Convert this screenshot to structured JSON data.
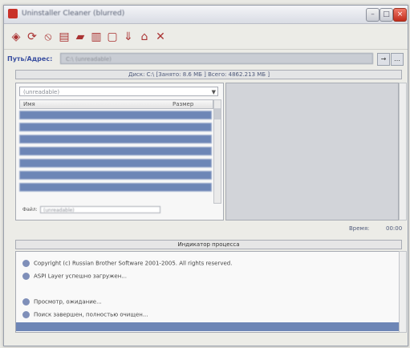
{
  "window": {
    "title": "Uninstaller Cleaner (blurred)"
  },
  "toolbar": {
    "icons": [
      "search-icon",
      "refresh-icon",
      "stop-icon",
      "document-icon",
      "folder-icon",
      "trash-icon",
      "settings-icon",
      "arrow-down-icon",
      "home-icon",
      "close-icon"
    ]
  },
  "address": {
    "label": "Путь/Адрес:",
    "value": "C:\\ (unreadable)"
  },
  "disk": {
    "info": "Диск: C:\\ [Занято: 8.6 МБ ]  Всего: 4862.213 МБ ]"
  },
  "left": {
    "dropdown": "(unreadable)",
    "col_name": "Имя",
    "col_size": "Размер",
    "rows": [
      "",
      "",
      "",
      "",
      "",
      "",
      ""
    ],
    "path_label": "Файл:",
    "path_value": "(unreadable)"
  },
  "status": {
    "left": "Время:",
    "right": "00:00"
  },
  "log": {
    "header": "Индикатор процесса",
    "items": [
      "Copyright (c) Russian Brother Software 2001-2005. All rights reserved.",
      "ASPI Layer успешно загружен...",
      "Просмотр, ожидание...",
      "Поиск завершен, полностью очищен..."
    ]
  }
}
